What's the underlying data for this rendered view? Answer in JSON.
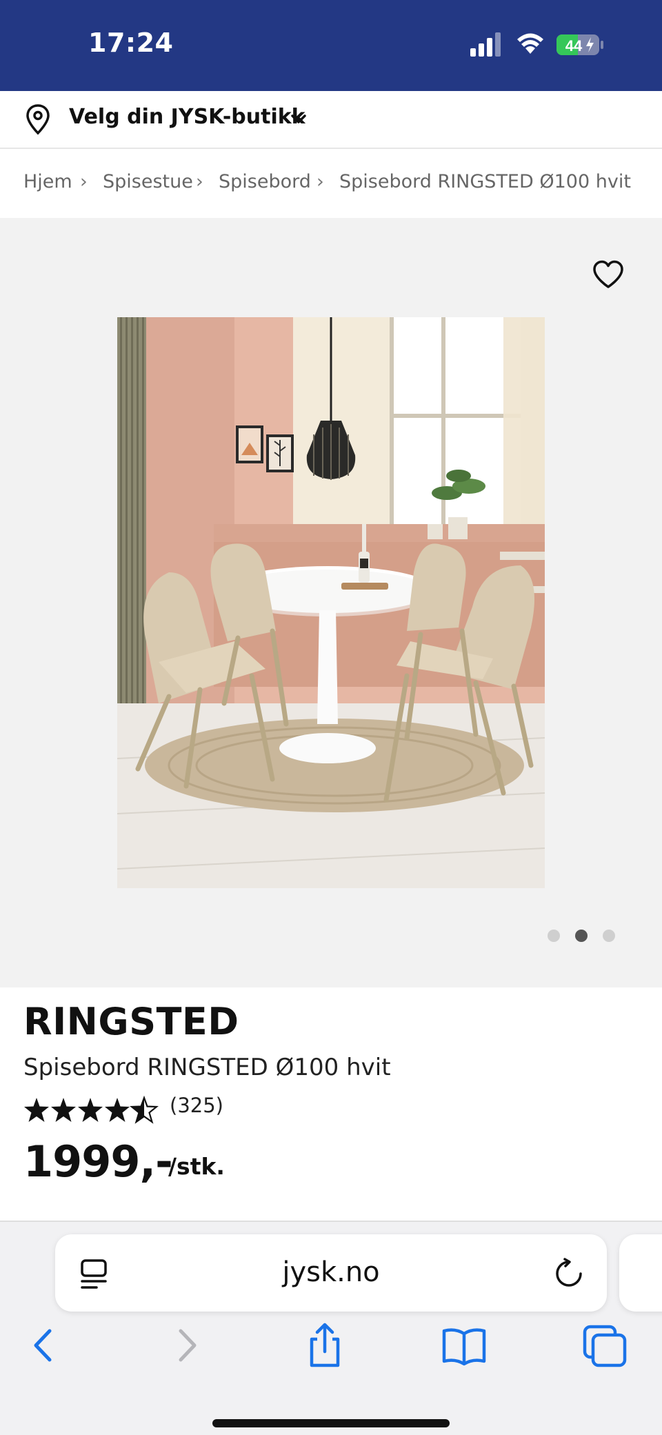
{
  "status_bar": {
    "time": "17:24",
    "battery_level": "44",
    "bg_color": "#233884"
  },
  "store_selector": {
    "label": "Velg din JYSK-butikk",
    "icons": [
      "location-pin-icon",
      "chevron-down-icon"
    ]
  },
  "breadcrumb": {
    "items": [
      "Hjem",
      "Spisestue",
      "Spisebord",
      "Spisebord RINGSTED Ø100 hvit"
    ],
    "separator": "›"
  },
  "gallery": {
    "image_count": 3,
    "active_index": 1,
    "favorite_icon": "heart-icon"
  },
  "product": {
    "brand": "RINGSTED",
    "name": "Spisebord RINGSTED Ø100 hvit",
    "rating": 4.5,
    "rating_count": "(325)",
    "price": "1999,-",
    "unit": "/stk."
  },
  "browser": {
    "url": "jysk.no",
    "icons": [
      "reader-icon",
      "reload-icon",
      "back-icon",
      "forward-icon",
      "share-icon",
      "bookmarks-icon",
      "tabs-icon"
    ],
    "accent_color": "#1a73e8"
  }
}
